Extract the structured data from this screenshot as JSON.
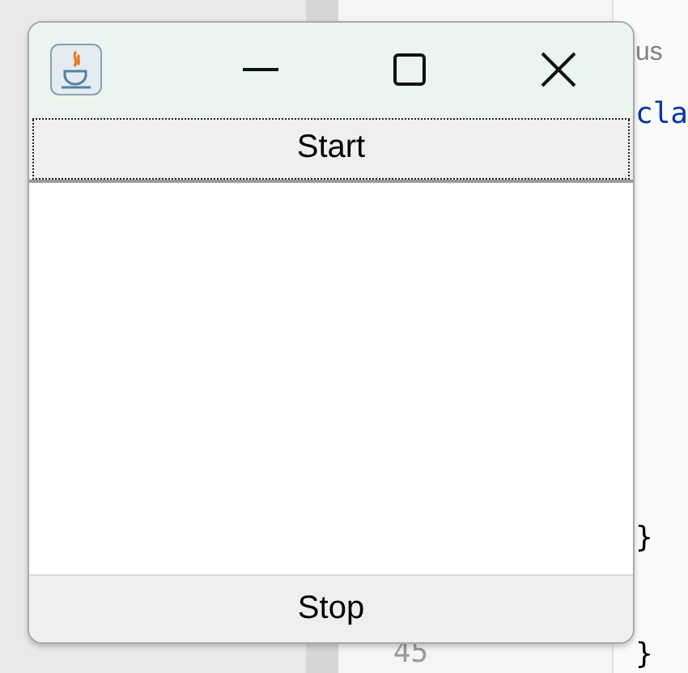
{
  "editor": {
    "code_fragments": [
      {
        "text": "us",
        "kind": "hint"
      },
      {
        "text": "cla",
        "kind": "keyword"
      },
      {
        "text": "}",
        "kind": "plain"
      },
      {
        "text": "}",
        "kind": "plain"
      }
    ],
    "line_number": "45"
  },
  "window": {
    "start_button": {
      "label": "Start",
      "focused": true
    },
    "stop_button": {
      "label": "Stop",
      "focused": false
    }
  }
}
